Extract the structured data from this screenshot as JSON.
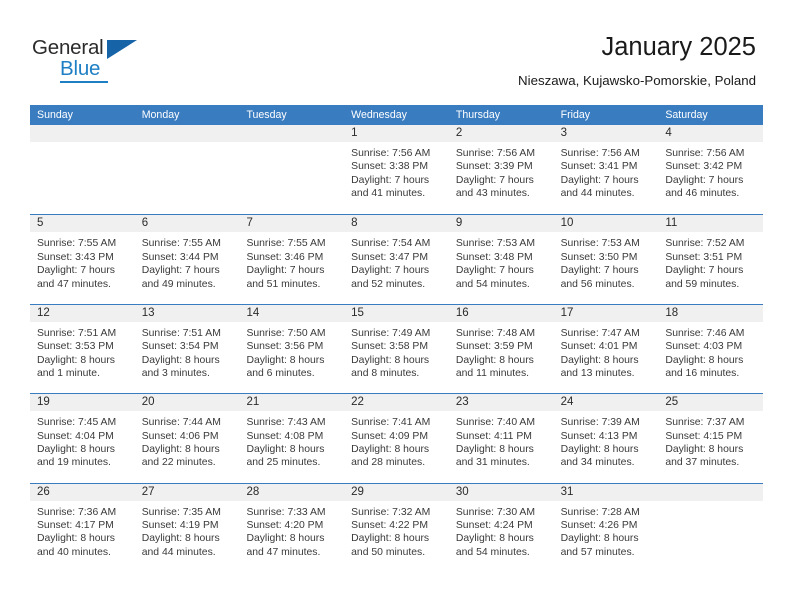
{
  "brand": {
    "word_one": "General",
    "word_two": "Blue",
    "flag_icon": "triangle-flag-icon"
  },
  "header": {
    "title": "January 2025",
    "subtitle": "Nieszawa, Kujawsko-Pomorskie, Poland"
  },
  "colors": {
    "header_blue": "#3a7cc0",
    "brand_blue": "#1f7fc4",
    "flag_blue": "#1763a8",
    "daynum_strip": "#f0f0f0",
    "text": "#3a3a3a"
  },
  "weekdays": [
    "Sunday",
    "Monday",
    "Tuesday",
    "Wednesday",
    "Thursday",
    "Friday",
    "Saturday"
  ],
  "weeks": [
    [
      {
        "day": "",
        "lines": []
      },
      {
        "day": "",
        "lines": []
      },
      {
        "day": "",
        "lines": []
      },
      {
        "day": "1",
        "lines": [
          "Sunrise: 7:56 AM",
          "Sunset: 3:38 PM",
          "Daylight: 7 hours",
          "and 41 minutes."
        ]
      },
      {
        "day": "2",
        "lines": [
          "Sunrise: 7:56 AM",
          "Sunset: 3:39 PM",
          "Daylight: 7 hours",
          "and 43 minutes."
        ]
      },
      {
        "day": "3",
        "lines": [
          "Sunrise: 7:56 AM",
          "Sunset: 3:41 PM",
          "Daylight: 7 hours",
          "and 44 minutes."
        ]
      },
      {
        "day": "4",
        "lines": [
          "Sunrise: 7:56 AM",
          "Sunset: 3:42 PM",
          "Daylight: 7 hours",
          "and 46 minutes."
        ]
      }
    ],
    [
      {
        "day": "5",
        "lines": [
          "Sunrise: 7:55 AM",
          "Sunset: 3:43 PM",
          "Daylight: 7 hours",
          "and 47 minutes."
        ]
      },
      {
        "day": "6",
        "lines": [
          "Sunrise: 7:55 AM",
          "Sunset: 3:44 PM",
          "Daylight: 7 hours",
          "and 49 minutes."
        ]
      },
      {
        "day": "7",
        "lines": [
          "Sunrise: 7:55 AM",
          "Sunset: 3:46 PM",
          "Daylight: 7 hours",
          "and 51 minutes."
        ]
      },
      {
        "day": "8",
        "lines": [
          "Sunrise: 7:54 AM",
          "Sunset: 3:47 PM",
          "Daylight: 7 hours",
          "and 52 minutes."
        ]
      },
      {
        "day": "9",
        "lines": [
          "Sunrise: 7:53 AM",
          "Sunset: 3:48 PM",
          "Daylight: 7 hours",
          "and 54 minutes."
        ]
      },
      {
        "day": "10",
        "lines": [
          "Sunrise: 7:53 AM",
          "Sunset: 3:50 PM",
          "Daylight: 7 hours",
          "and 56 minutes."
        ]
      },
      {
        "day": "11",
        "lines": [
          "Sunrise: 7:52 AM",
          "Sunset: 3:51 PM",
          "Daylight: 7 hours",
          "and 59 minutes."
        ]
      }
    ],
    [
      {
        "day": "12",
        "lines": [
          "Sunrise: 7:51 AM",
          "Sunset: 3:53 PM",
          "Daylight: 8 hours",
          "and 1 minute."
        ]
      },
      {
        "day": "13",
        "lines": [
          "Sunrise: 7:51 AM",
          "Sunset: 3:54 PM",
          "Daylight: 8 hours",
          "and 3 minutes."
        ]
      },
      {
        "day": "14",
        "lines": [
          "Sunrise: 7:50 AM",
          "Sunset: 3:56 PM",
          "Daylight: 8 hours",
          "and 6 minutes."
        ]
      },
      {
        "day": "15",
        "lines": [
          "Sunrise: 7:49 AM",
          "Sunset: 3:58 PM",
          "Daylight: 8 hours",
          "and 8 minutes."
        ]
      },
      {
        "day": "16",
        "lines": [
          "Sunrise: 7:48 AM",
          "Sunset: 3:59 PM",
          "Daylight: 8 hours",
          "and 11 minutes."
        ]
      },
      {
        "day": "17",
        "lines": [
          "Sunrise: 7:47 AM",
          "Sunset: 4:01 PM",
          "Daylight: 8 hours",
          "and 13 minutes."
        ]
      },
      {
        "day": "18",
        "lines": [
          "Sunrise: 7:46 AM",
          "Sunset: 4:03 PM",
          "Daylight: 8 hours",
          "and 16 minutes."
        ]
      }
    ],
    [
      {
        "day": "19",
        "lines": [
          "Sunrise: 7:45 AM",
          "Sunset: 4:04 PM",
          "Daylight: 8 hours",
          "and 19 minutes."
        ]
      },
      {
        "day": "20",
        "lines": [
          "Sunrise: 7:44 AM",
          "Sunset: 4:06 PM",
          "Daylight: 8 hours",
          "and 22 minutes."
        ]
      },
      {
        "day": "21",
        "lines": [
          "Sunrise: 7:43 AM",
          "Sunset: 4:08 PM",
          "Daylight: 8 hours",
          "and 25 minutes."
        ]
      },
      {
        "day": "22",
        "lines": [
          "Sunrise: 7:41 AM",
          "Sunset: 4:09 PM",
          "Daylight: 8 hours",
          "and 28 minutes."
        ]
      },
      {
        "day": "23",
        "lines": [
          "Sunrise: 7:40 AM",
          "Sunset: 4:11 PM",
          "Daylight: 8 hours",
          "and 31 minutes."
        ]
      },
      {
        "day": "24",
        "lines": [
          "Sunrise: 7:39 AM",
          "Sunset: 4:13 PM",
          "Daylight: 8 hours",
          "and 34 minutes."
        ]
      },
      {
        "day": "25",
        "lines": [
          "Sunrise: 7:37 AM",
          "Sunset: 4:15 PM",
          "Daylight: 8 hours",
          "and 37 minutes."
        ]
      }
    ],
    [
      {
        "day": "26",
        "lines": [
          "Sunrise: 7:36 AM",
          "Sunset: 4:17 PM",
          "Daylight: 8 hours",
          "and 40 minutes."
        ]
      },
      {
        "day": "27",
        "lines": [
          "Sunrise: 7:35 AM",
          "Sunset: 4:19 PM",
          "Daylight: 8 hours",
          "and 44 minutes."
        ]
      },
      {
        "day": "28",
        "lines": [
          "Sunrise: 7:33 AM",
          "Sunset: 4:20 PM",
          "Daylight: 8 hours",
          "and 47 minutes."
        ]
      },
      {
        "day": "29",
        "lines": [
          "Sunrise: 7:32 AM",
          "Sunset: 4:22 PM",
          "Daylight: 8 hours",
          "and 50 minutes."
        ]
      },
      {
        "day": "30",
        "lines": [
          "Sunrise: 7:30 AM",
          "Sunset: 4:24 PM",
          "Daylight: 8 hours",
          "and 54 minutes."
        ]
      },
      {
        "day": "31",
        "lines": [
          "Sunrise: 7:28 AM",
          "Sunset: 4:26 PM",
          "Daylight: 8 hours",
          "and 57 minutes."
        ]
      },
      {
        "day": "",
        "lines": []
      }
    ]
  ]
}
